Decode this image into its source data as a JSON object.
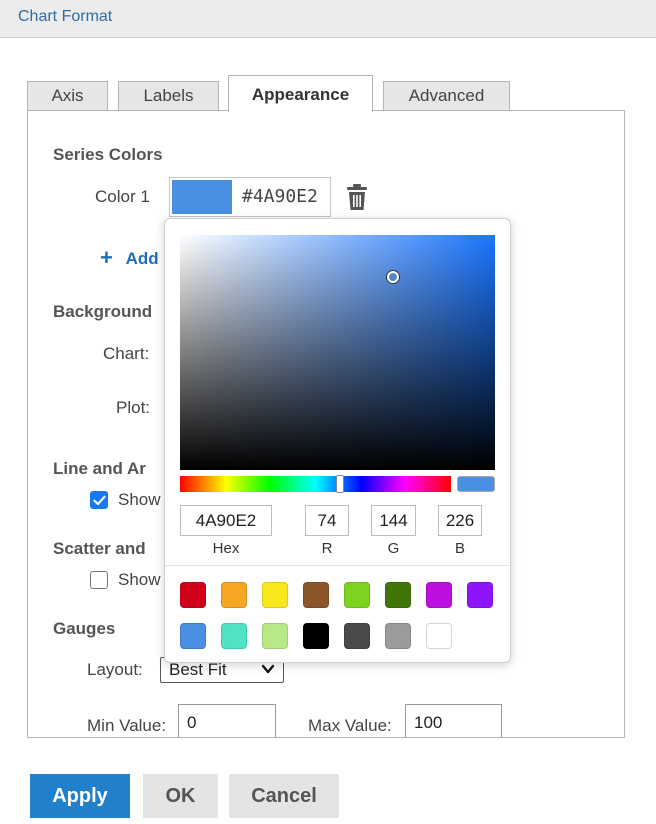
{
  "window": {
    "title": "Chart Format"
  },
  "tabs": [
    {
      "label": "Axis"
    },
    {
      "label": "Labels"
    },
    {
      "label": "Appearance"
    },
    {
      "label": "Advanced"
    }
  ],
  "series_colors": {
    "title": "Series Colors",
    "color1_label": "Color 1",
    "color1_hex": "#4A90E2",
    "color1_value": "#4A90E2",
    "add_label": "Add"
  },
  "background": {
    "title": "Background",
    "chart_label": "Chart:",
    "plot_label": "Plot:"
  },
  "line_area": {
    "title": "Line and Ar",
    "show_label": "Show",
    "show_checked": true
  },
  "scatter": {
    "title": "Scatter and",
    "show_label": "Show",
    "show_checked": false
  },
  "gauges": {
    "title": "Gauges",
    "layout_label": "Layout:",
    "layout_value": "Best Fit",
    "min_label": "Min Value:",
    "min_value": "0",
    "max_label": "Max Value:",
    "max_value": "100"
  },
  "picker": {
    "base_hue": "#1a75ff",
    "hex_value": "4A90E2",
    "r_value": "74",
    "g_value": "144",
    "b_value": "226",
    "hex_label": "Hex",
    "r_label": "R",
    "g_label": "G",
    "b_label": "B",
    "presets": [
      "#D0021B",
      "#F5A623",
      "#F8E71C",
      "#8B572A",
      "#7ED321",
      "#417505",
      "#BD10E0",
      "#9013FE",
      "#4A90E2",
      "#50E3C2",
      "#B8E986",
      "#000000",
      "#4A4A4A",
      "#9B9B9B",
      "#FFFFFF"
    ]
  },
  "buttons": {
    "apply": "Apply",
    "ok": "OK",
    "cancel": "Cancel"
  }
}
